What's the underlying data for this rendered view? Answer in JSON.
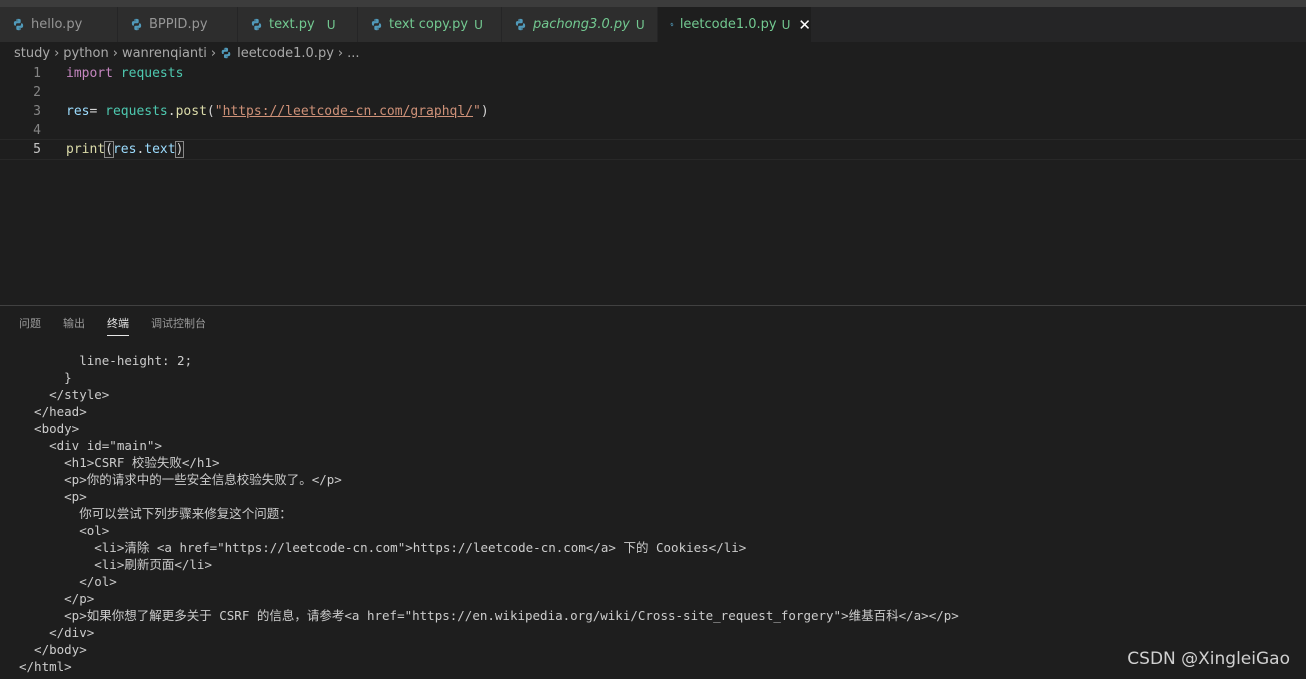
{
  "tabs": [
    {
      "name": "hello.py",
      "badge": "",
      "state": "normal"
    },
    {
      "name": "BPPID.py",
      "badge": "",
      "state": "normal"
    },
    {
      "name": "text.py",
      "badge": "U",
      "state": "modified"
    },
    {
      "name": "text copy.py",
      "badge": "U",
      "state": "modified"
    },
    {
      "name": "pachong3.0.py",
      "badge": "U",
      "state": "preview"
    },
    {
      "name": "leetcode1.0.py",
      "badge": "U",
      "state": "active",
      "close": "✕"
    }
  ],
  "breadcrumb": {
    "parts": [
      "study",
      "python",
      "wanrenqianti"
    ],
    "file": "leetcode1.0.py",
    "ellipsis": "..."
  },
  "editor": {
    "line_numbers": [
      "1",
      "2",
      "3",
      "4",
      "5"
    ],
    "line1": {
      "kw": "import",
      "mod": "requests"
    },
    "line3": {
      "var": "res",
      "eq": "=",
      "obj": "requests",
      "dot": ".",
      "fn": "post",
      "open": "(",
      "q1": "\"",
      "url": "https://leetcode-cn.com/graphql/",
      "q2": "\"",
      "close": ")"
    },
    "line5": {
      "fn": "print",
      "open": "(",
      "var": "res",
      "dot": ".",
      "attr": "text",
      "close": ")"
    }
  },
  "panel_tabs": [
    "问题",
    "输出",
    "终端",
    "调试控制台"
  ],
  "terminal_lines": [
    "        line-height: 2;",
    "      }",
    "    </style>",
    "  </head>",
    "  <body>",
    "    <div id=\"main\">",
    "      <h1>CSRF 校验失败</h1>",
    "      <p>你的请求中的一些安全信息校验失败了。</p>",
    "      <p>",
    "        你可以尝试下列步骤来修复这个问题：",
    "        <ol>",
    "          <li>清除 <a href=\"https://leetcode-cn.com\">https://leetcode-cn.com</a> 下的 Cookies</li>",
    "          <li>刷新页面</li>",
    "        </ol>",
    "      </p>",
    "      <p>如果你想了解更多关于 CSRF 的信息，请参考<a href=\"https://en.wikipedia.org/wiki/Cross-site_request_forgery\">维基百科</a></p>",
    "    </div>",
    "  </body>",
    "</html>"
  ],
  "watermark": "CSDN @XingleiGao"
}
